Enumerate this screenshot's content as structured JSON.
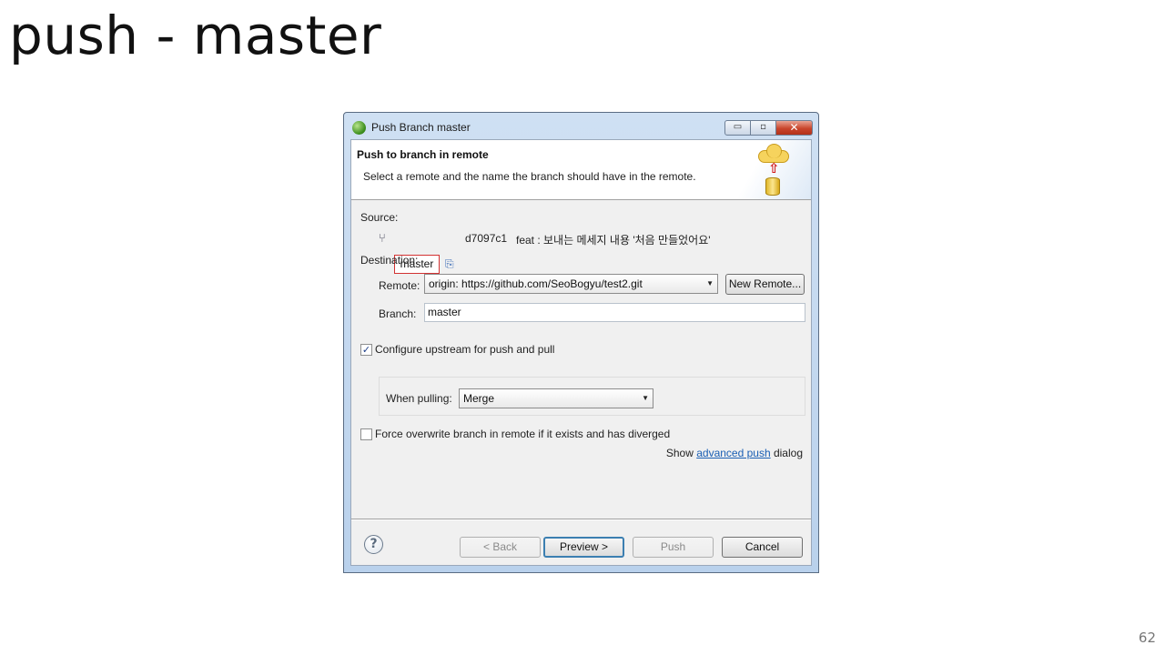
{
  "slide": {
    "title": "push - master",
    "page_number": "62"
  },
  "window": {
    "title": "Push Branch master",
    "controls": {
      "minimize": "▭",
      "maximize": "▫",
      "close": "✕"
    }
  },
  "banner": {
    "title": "Push to branch in remote",
    "description": "Select a remote and the name the branch should have in the remote."
  },
  "source": {
    "label": "Source:",
    "branch": "master",
    "commit_id": "d7097c1",
    "commit_message": "feat : 보내는 메세지 내용 '처음 만들었어요'"
  },
  "destination": {
    "label": "Destination:",
    "remote_label": "Remote:",
    "remote_value": "origin: https://github.com/SeoBogyu/test2.git",
    "new_remote_button": "New Remote...",
    "branch_label": "Branch:",
    "branch_value": "master"
  },
  "options": {
    "configure_upstream": {
      "label": "Configure upstream for push and pull",
      "checked": true
    },
    "when_pulling_label": "When pulling:",
    "when_pulling_value": "Merge",
    "force_overwrite": {
      "label": "Force overwrite branch in remote if it exists and has diverged",
      "checked": false
    },
    "advanced_prefix": "Show",
    "advanced_link": "advanced push",
    "advanced_suffix": "dialog"
  },
  "buttons": {
    "back": "< Back",
    "preview": "Preview >",
    "push": "Push",
    "cancel": "Cancel"
  },
  "icons": {
    "help": "?",
    "branch": "⑂",
    "commit": "⎘",
    "combo_arrow": "▼",
    "check": "✓"
  }
}
